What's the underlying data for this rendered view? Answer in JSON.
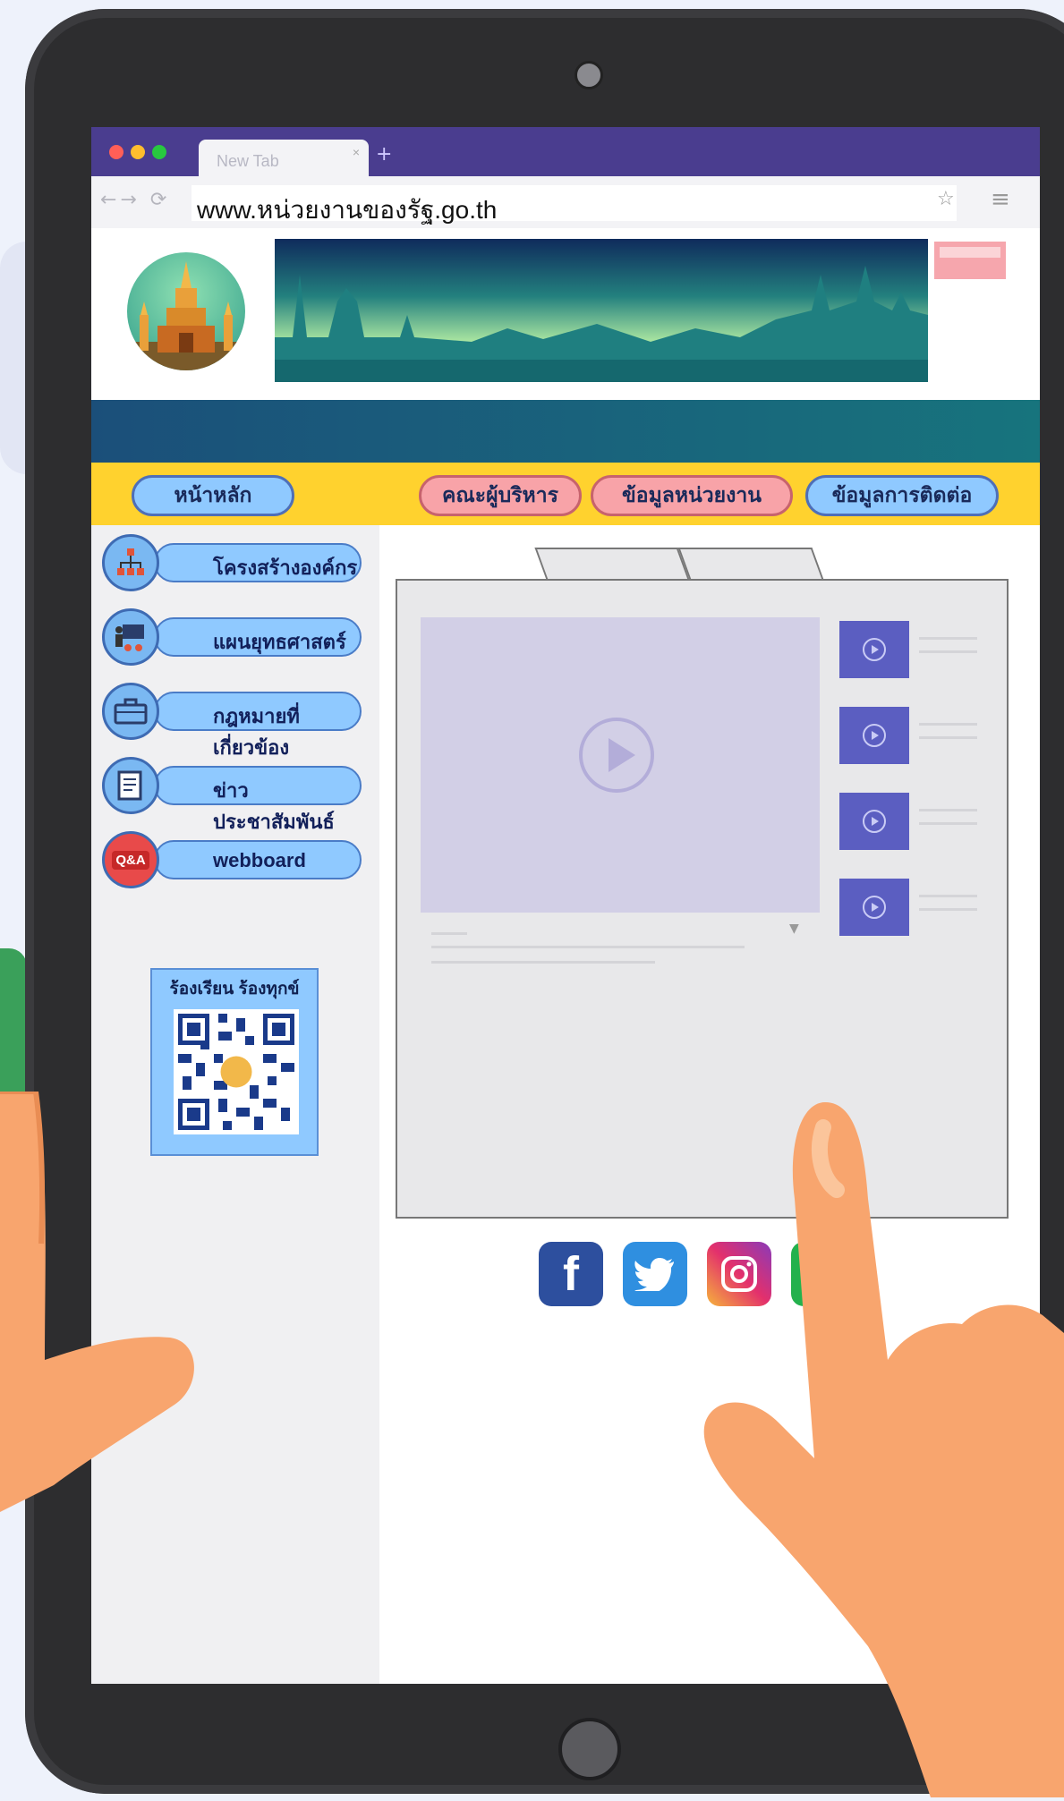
{
  "browser": {
    "tab_title": "New Tab",
    "new_tab_symbol": "+",
    "url": "www.หน่วยงานของรัฐ.go.th",
    "nav_symbols": "←→ ⟳",
    "bookmark_symbol": "☆",
    "menu_symbol": "≡"
  },
  "nav": {
    "home": "หน้าหลัก",
    "executives": "คณะผู้บริหาร",
    "agency_info": "ข้อมูลหน่วยงาน",
    "contact": "ข้อมูลการติดต่อ"
  },
  "sidebar": {
    "items": [
      {
        "label": "โครงสร้างองค์กร",
        "icon": "org-chart-icon"
      },
      {
        "label": "แผนยุทธศาสตร์",
        "icon": "strategy-plan-icon"
      },
      {
        "label": "กฎหมายที่เกี่ยวข้อง",
        "icon": "briefcase-icon"
      },
      {
        "label": "ข่าวประชาสัมพันธ์",
        "icon": "newspaper-icon"
      },
      {
        "label": "webboard",
        "icon": "qa-chat-icon"
      }
    ],
    "qa_badge": "Q&A",
    "complaint_title": "ร้องเรียน ร้องทุกข์"
  },
  "social": [
    {
      "name": "facebook",
      "glyph": "f",
      "color": "#2d4f9e"
    },
    {
      "name": "twitter",
      "glyph": "t",
      "color": "#2f8fe0"
    },
    {
      "name": "instagram",
      "glyph": "◎",
      "color": "#d6307d"
    },
    {
      "name": "line",
      "glyph": "",
      "color": "#23b14d"
    }
  ],
  "colors": {
    "tabbar": "#4a3d8f",
    "nav_bar": "#ffd22e",
    "nav_blue": "#8fc9ff",
    "nav_pink": "#f8a3a8",
    "video_thumb": "#5b5ec1"
  }
}
